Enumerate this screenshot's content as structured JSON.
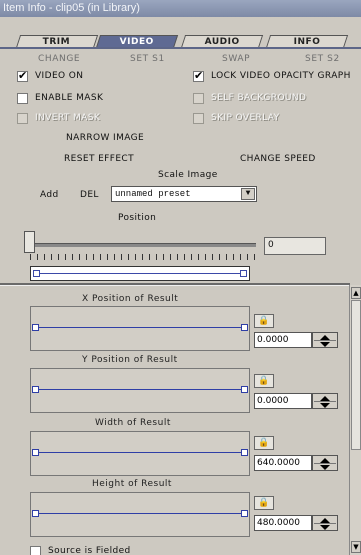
{
  "window": {
    "title": "Item Info - clip05 (in Library)"
  },
  "tabs": [
    {
      "label": "TRIM",
      "active": false
    },
    {
      "label": "VIDEO",
      "active": true
    },
    {
      "label": "AUDIO",
      "active": false
    },
    {
      "label": "INFO",
      "active": false
    }
  ],
  "subactions": {
    "change": "CHANGE",
    "set_s1": "SET S1",
    "swap": "SWAP",
    "set_s2": "SET S2"
  },
  "checks": {
    "video_on": {
      "label": "VIDEO ON",
      "checked": true
    },
    "lock_video_opacity": {
      "label": "LOCK VIDEO OPACITY GRAPH",
      "checked": true
    },
    "enable_mask": {
      "label": "ENABLE MASK",
      "checked": false
    },
    "self_background": {
      "label": "SELF BACKGROUND",
      "checked": false
    },
    "invert_mask": {
      "label": "INVERT MASK",
      "checked": false
    },
    "skip_overlay": {
      "label": "SKIP OVERLAY",
      "checked": false
    }
  },
  "actions": {
    "narrow_image": "NARROW IMAGE",
    "reset_effect": "RESET EFFECT",
    "change_speed": "CHANGE SPEED",
    "scale_image": "Scale Image",
    "add": "Add",
    "del": "DEL"
  },
  "preset": {
    "selected": "unnamed preset"
  },
  "position": {
    "label": "Position",
    "value": "0"
  },
  "graphs": [
    {
      "title": "X Position of Result",
      "value": "0.0000"
    },
    {
      "title": "Y Position of Result",
      "value": "0.0000"
    },
    {
      "title": "Width of Result",
      "value": "640.0000"
    },
    {
      "title": "Height of Result",
      "value": "480.0000"
    }
  ],
  "footer": {
    "partial_label": "Source is Fielded"
  }
}
